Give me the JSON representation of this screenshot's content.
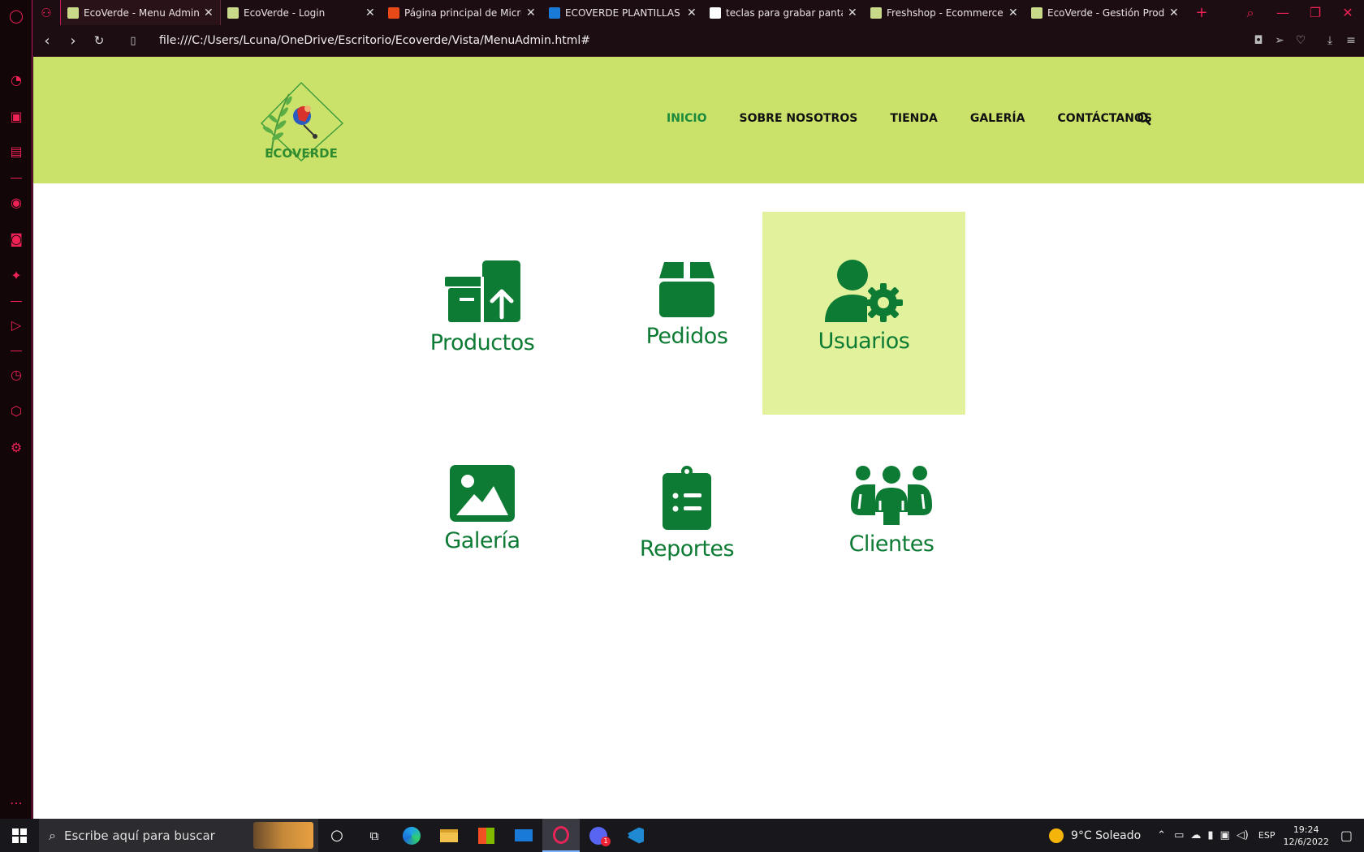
{
  "browser": {
    "tabs": [
      {
        "title": "EcoVerde - Menu Administr",
        "active": true,
        "favicon": "ecoverde-favicon"
      },
      {
        "title": "EcoVerde - Login",
        "active": false,
        "favicon": "ecoverde-favicon"
      },
      {
        "title": "Página principal de Micros",
        "active": false,
        "favicon": "office-favicon"
      },
      {
        "title": "ECOVERDE PLANTILLAS - C",
        "active": false,
        "favicon": "onedrive-favicon"
      },
      {
        "title": "teclas para grabar pantalla",
        "active": false,
        "favicon": "google-favicon"
      },
      {
        "title": "Freshshop - Ecommerce Bo",
        "active": false,
        "favicon": "ecoverde-favicon"
      },
      {
        "title": "EcoVerde - Gestión Product",
        "active": false,
        "favicon": "ecoverde-favicon"
      }
    ],
    "url": "file:///C:/Users/Lcuna/OneDrive/Escritorio/Ecoverde/Vista/MenuAdmin.html#",
    "accent": "#e6245a"
  },
  "site": {
    "logo_text": "ECOVERDE",
    "nav": [
      {
        "label": "INICIO",
        "active": true
      },
      {
        "label": "SOBRE NOSOTROS",
        "active": false
      },
      {
        "label": "TIENDA",
        "active": false
      },
      {
        "label": "GALERÍA",
        "active": false
      },
      {
        "label": "CONTÁCTANOS",
        "active": false
      }
    ],
    "header_color": "#cbe26a",
    "brand_green": "#0d7b34"
  },
  "menu_cards": [
    {
      "label": "Productos",
      "icon": "boxes-arrow-up-icon",
      "selected": false
    },
    {
      "label": "Pedidos",
      "icon": "box-icon",
      "selected": false
    },
    {
      "label": "Usuarios",
      "icon": "user-gear-icon",
      "selected": true
    },
    {
      "label": "Galería",
      "icon": "image-icon",
      "selected": false
    },
    {
      "label": "Reportes",
      "icon": "clipboard-list-icon",
      "selected": false
    },
    {
      "label": "Clientes",
      "icon": "people-group-icon",
      "selected": false
    }
  ],
  "taskbar": {
    "search_placeholder": "Escribe aquí para buscar",
    "weather": "9°C  Soleado",
    "language": "ESP",
    "time": "19:24",
    "date": "12/6/2022",
    "discord_badge": "1"
  }
}
